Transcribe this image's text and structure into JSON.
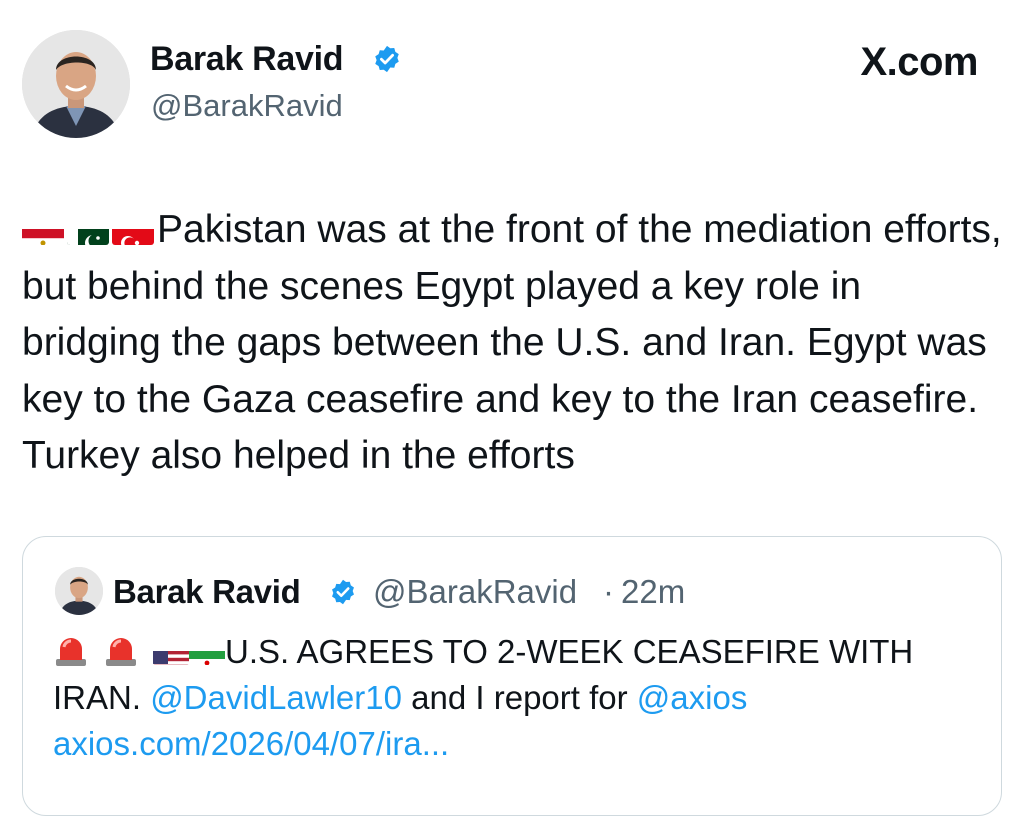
{
  "tweet": {
    "author_name": "Barak Ravid",
    "author_handle": "@BarakRavid",
    "site_logo": "X.com",
    "text": "Pakistan was at the front of the mediation efforts, but behind the scenes Egypt played a key role in bridging the gaps between the U.S. and Iran. Egypt was key to the Gaza ceasefire and key to the Iran ceasefire. Turkey also helped in the efforts",
    "leading_flags": [
      "egypt-flag-icon",
      "pakistan-flag-icon",
      "turkey-flag-icon"
    ]
  },
  "quote": {
    "author_name": "Barak Ravid",
    "author_handle": "@BarakRavid",
    "separator": "·",
    "time": "22m",
    "leading_icons": [
      "siren-icon",
      "siren-icon",
      "us-flag-icon",
      "iran-flag-icon"
    ],
    "text_main": "U.S. AGREES TO 2-WEEK CEASEFIRE WITH IRAN.",
    "mention_1": "@DavidLawler10",
    "text_mid": "and I report for",
    "mention_2": "@axios",
    "link": "axios.com/2026/04/07/ira..."
  },
  "colors": {
    "text": "#0f1419",
    "secondary": "#536471",
    "accent": "#1d9bf0",
    "border": "#cfd9de"
  }
}
